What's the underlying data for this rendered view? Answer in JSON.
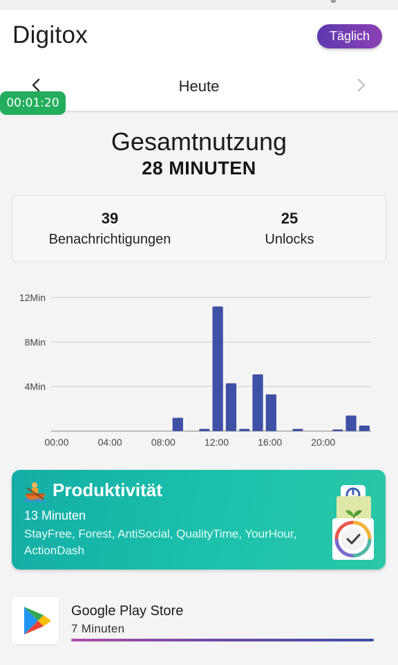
{
  "app": {
    "title": "Digitox",
    "period_button": "Täglich",
    "timer": "00:01:20"
  },
  "nav": {
    "day_label": "Heute"
  },
  "summary": {
    "title": "Gesamtnutzung",
    "value": "28 MINUTEN"
  },
  "stats": {
    "notifications": {
      "value": "39",
      "label": "Benachrichtigungen"
    },
    "unlocks": {
      "value": "25",
      "label": "Unlocks"
    }
  },
  "chart_data": {
    "type": "bar",
    "x": [
      0,
      1,
      2,
      3,
      4,
      5,
      6,
      7,
      8,
      9,
      10,
      11,
      12,
      13,
      14,
      15,
      16,
      17,
      18,
      19,
      20,
      21,
      22,
      23
    ],
    "values": [
      0,
      0,
      0,
      0,
      0,
      0,
      0,
      0,
      0,
      1.2,
      0,
      0.2,
      11.2,
      4.3,
      0.2,
      5.1,
      3.3,
      0,
      0.2,
      0,
      0,
      0.15,
      1.4,
      0.5
    ],
    "xticks": [
      "00:00",
      "04:00",
      "08:00",
      "12:00",
      "16:00",
      "20:00"
    ],
    "yticks": [
      "4Min",
      "8Min",
      "12Min"
    ],
    "ylim": [
      0,
      12
    ],
    "grid": true,
    "bar_color": "#3f51a5"
  },
  "productivity": {
    "title": "Produktivität",
    "minutes": "13 Minuten",
    "apps": "StayFree, Forest, AntiSocial, QualityTime, YourHour, ActionDash"
  },
  "app_usage": [
    {
      "name": "Google Play Store",
      "time": "7 Minuten",
      "fraction": 1.0,
      "icon": "google-play-icon"
    }
  ]
}
